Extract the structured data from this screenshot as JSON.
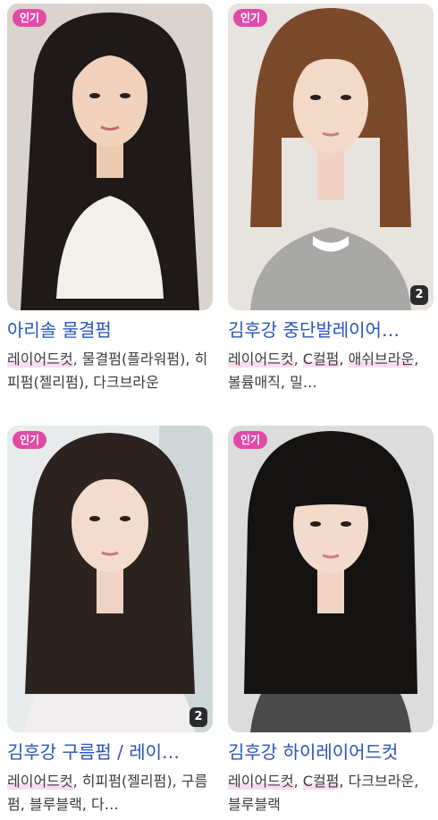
{
  "colors": {
    "badge_bg": "#e24aa8",
    "title_link": "#2a54b9",
    "description_text": "#3c3c3c",
    "highlight": "#f8dcef",
    "count_bg": "#2b2b2b"
  },
  "cards": [
    {
      "badge": "인기",
      "title": "아리솔 물결펌",
      "tags": [
        "레이어드컷",
        "물결펌(플라워펌)",
        "히피펌(젤리펌)",
        "다크브라운"
      ],
      "description": "레이어드컷, 물결펌(플라워펌), 히피펌(젤리펌), 다크…",
      "image_count": null,
      "photo_description": "woman with long wavy dark hair in white top"
    },
    {
      "badge": "인기",
      "title": "김후강 중단발레이어…",
      "tags": [
        "레이어드컷",
        "C컬펌",
        "애쉬브라운",
        "볼륨매직"
      ],
      "description": "레이어드컷, C컬펌, 애쉬브라운, 볼륨매직, 밀…",
      "image_count": "2",
      "photo_description": "woman with shoulder-length brown layered hair and bangs"
    },
    {
      "badge": "인기",
      "title": "김후강 구름펌 / 레이…",
      "tags": [
        "레이어드컷",
        "히피펌(젤리펌)",
        "구름펌",
        "블루블랙"
      ],
      "description": "레이어드컷, 히피펌(젤리펌), 구름펌, 블루블랙, 다…",
      "image_count": "2",
      "photo_description": "woman with long wavy dark hair in white blouse"
    },
    {
      "badge": "인기",
      "title": "김후강 하이레이어드컷",
      "tags": [
        "레이어드컷",
        "C컬펌",
        "다크브라운",
        "블루블랙"
      ],
      "description": "레이어드컷, C컬펌, 다크브라운, 블루블랙",
      "image_count": null,
      "photo_description": "woman with long black layered hair and bangs"
    }
  ]
}
